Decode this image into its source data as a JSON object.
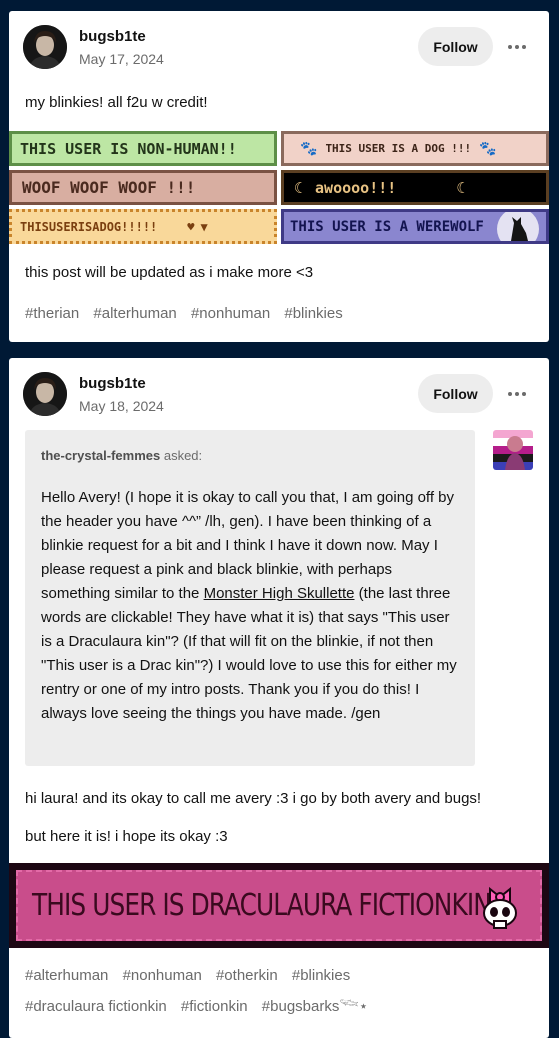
{
  "posts": [
    {
      "username": "bugsb1te",
      "date": "May 17, 2024",
      "follow_label": "Follow",
      "body": "my blinkies! all f2u w credit!",
      "blinkies": [
        "THIS USER IS NON-HUMAN!!",
        "THIS USER IS A DOG !!!",
        "WOOF WOOF WOOF !!!",
        "awoooo!!!",
        "THISUSERISADOG!!!!!",
        "THIS USER IS A WEREWOLF"
      ],
      "footer_text": "this post will be updated as i make more <3",
      "tags": [
        "#therian",
        "#alterhuman",
        "#nonhuman",
        "#blinkies"
      ]
    },
    {
      "username": "bugsb1te",
      "date": "May 18, 2024",
      "follow_label": "Follow",
      "asker": "the-crystal-femmes",
      "asked_label": "asked:",
      "question_before_link": "Hello Avery! (I hope it is okay to call you that, I am going off by the header you have ^^” /lh, gen). I have been thinking of a blinkie request for a bit and I think I have it down now. May I please request a pink and black blinkie, with perhaps something similar to the ",
      "question_link": "Monster High Skullette",
      "question_after_link": " (the last three words are clickable! They have what it is) that says \"This user is a Draculaura kin\"? (If that will fit on the blinkie, if not then \"This user is a Drac kin\"?) I would love to use this for either my rentry or one of my intro posts. Thank you if you do this! I always love seeing the things you have made. /gen",
      "answer_1": "hi laura! and its okay to call me avery :3 i go by both avery and bugs!",
      "answer_2": "but here it is! i hope its okay :3",
      "banner_text": "THIS USER IS DRACULAURA FICTIONKIN",
      "tags_row1": [
        "#alterhuman",
        "#nonhuman",
        "#otherkin",
        "#blinkies"
      ],
      "tags_row2": [
        "#draculaura fictionkin",
        "#fictionkin",
        "#bugsbarks𓆝⋆"
      ]
    }
  ]
}
